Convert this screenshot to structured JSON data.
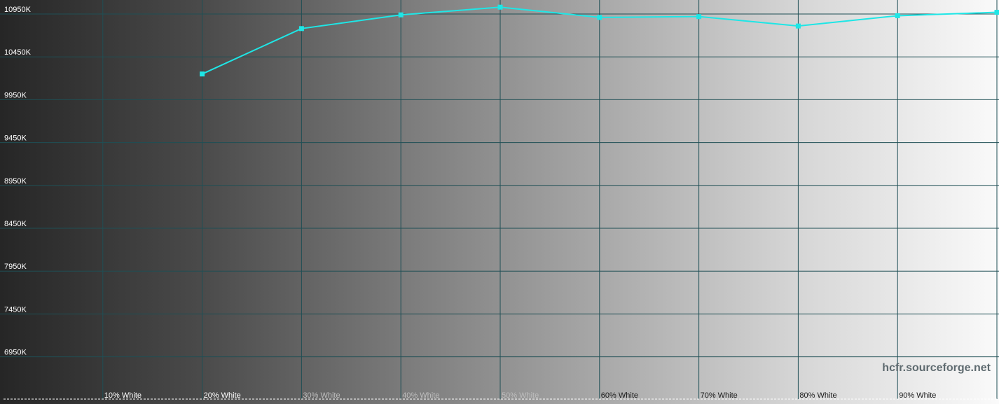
{
  "chart_data": {
    "type": "line",
    "title": "",
    "xlabel": "",
    "ylabel": "",
    "categories": [
      "",
      "10% White",
      "20% White",
      "30% White",
      "40% White",
      "50% White",
      "60% White",
      "70% White",
      "80% White",
      "90% White",
      ""
    ],
    "yticks": [
      "10950K",
      "10450K",
      "9950K",
      "9450K",
      "8950K",
      "8450K",
      "7950K",
      "7450K",
      "6950K"
    ],
    "ylim": [
      6550,
      11050
    ],
    "series": [
      {
        "color": "#1ee6e6",
        "values": [
          null,
          null,
          10250,
          10780,
          10940,
          11030,
          10910,
          10920,
          10810,
          10930,
          10970
        ]
      }
    ],
    "grid": true,
    "background": "gray-ramp-black-to-white"
  },
  "watermark": "hcfr.sourceforge.net",
  "colors": {
    "grid": "#1f4f55",
    "series": "#1ee6e6",
    "tick_text": "#ffffff"
  }
}
